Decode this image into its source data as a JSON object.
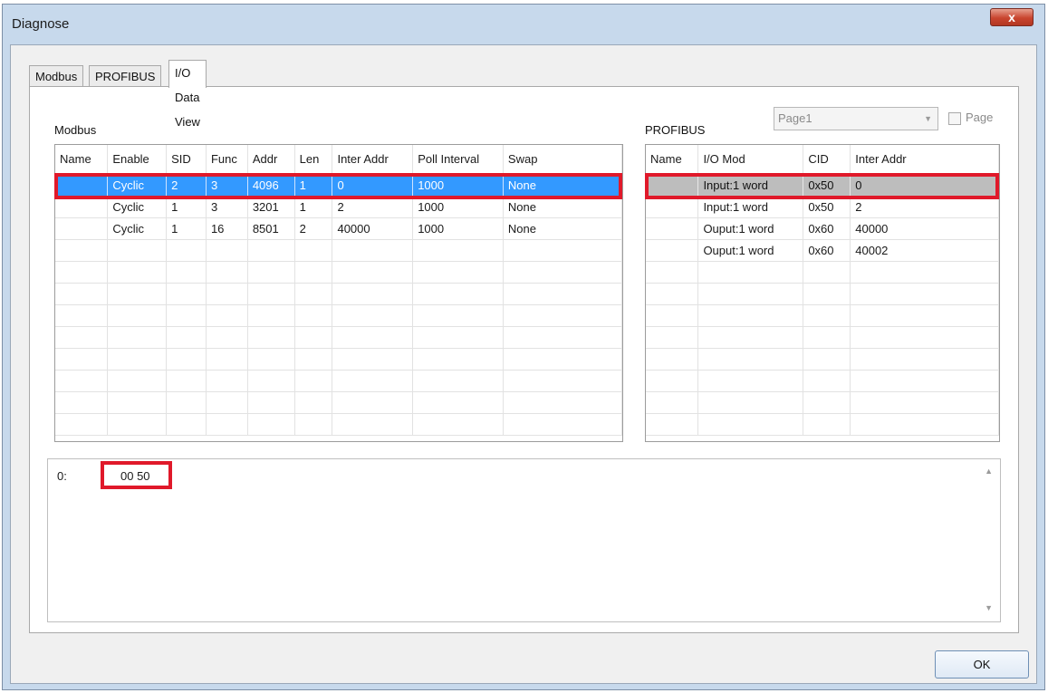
{
  "window": {
    "title": "Diagnose",
    "close_glyph": "x"
  },
  "tabs": [
    {
      "label": "Modbus"
    },
    {
      "label": "PROFIBUS"
    },
    {
      "label": "I/O Data View"
    }
  ],
  "modbus": {
    "label": "Modbus",
    "columns": [
      "Name",
      "Enable",
      "SID",
      "Func",
      "Addr",
      "Len",
      "Inter Addr",
      "Poll Interval",
      "Swap"
    ],
    "rows": [
      [
        "",
        "Cyclic",
        "2",
        "3",
        "4096",
        "1",
        "0",
        "1000",
        "None"
      ],
      [
        "",
        "Cyclic",
        "1",
        "3",
        "3201",
        "1",
        "2",
        "1000",
        "None"
      ],
      [
        "",
        "Cyclic",
        "1",
        "16",
        "8501",
        "2",
        "40000",
        "1000",
        "None"
      ]
    ],
    "selected_row": 0
  },
  "profibus": {
    "label": "PROFIBUS",
    "page_select": "Page1",
    "page_checkbox_label": "Page",
    "page_checked": false,
    "columns": [
      "Name",
      "I/O Mod",
      "CID",
      "Inter Addr"
    ],
    "rows": [
      [
        "",
        "Input:1 word",
        "0x50",
        "0"
      ],
      [
        "",
        "Input:1 word",
        "0x50",
        "2"
      ],
      [
        "",
        "Ouput:1 word",
        "0x60",
        "40000"
      ],
      [
        "",
        "Ouput:1 word",
        "0x60",
        "40002"
      ]
    ],
    "selected_row": 0
  },
  "output": {
    "address": "0:",
    "value": "00 50"
  },
  "buttons": {
    "ok": "OK"
  },
  "colors": {
    "selection_blue": "#3399ff",
    "selection_grey": "#bdbdbd",
    "highlight_red": "#e0192a"
  },
  "icons": {
    "close": "close-icon",
    "dropdown": "chevron-down-icon",
    "scroll_up": "scroll-up-icon",
    "scroll_down": "scroll-down-icon"
  }
}
